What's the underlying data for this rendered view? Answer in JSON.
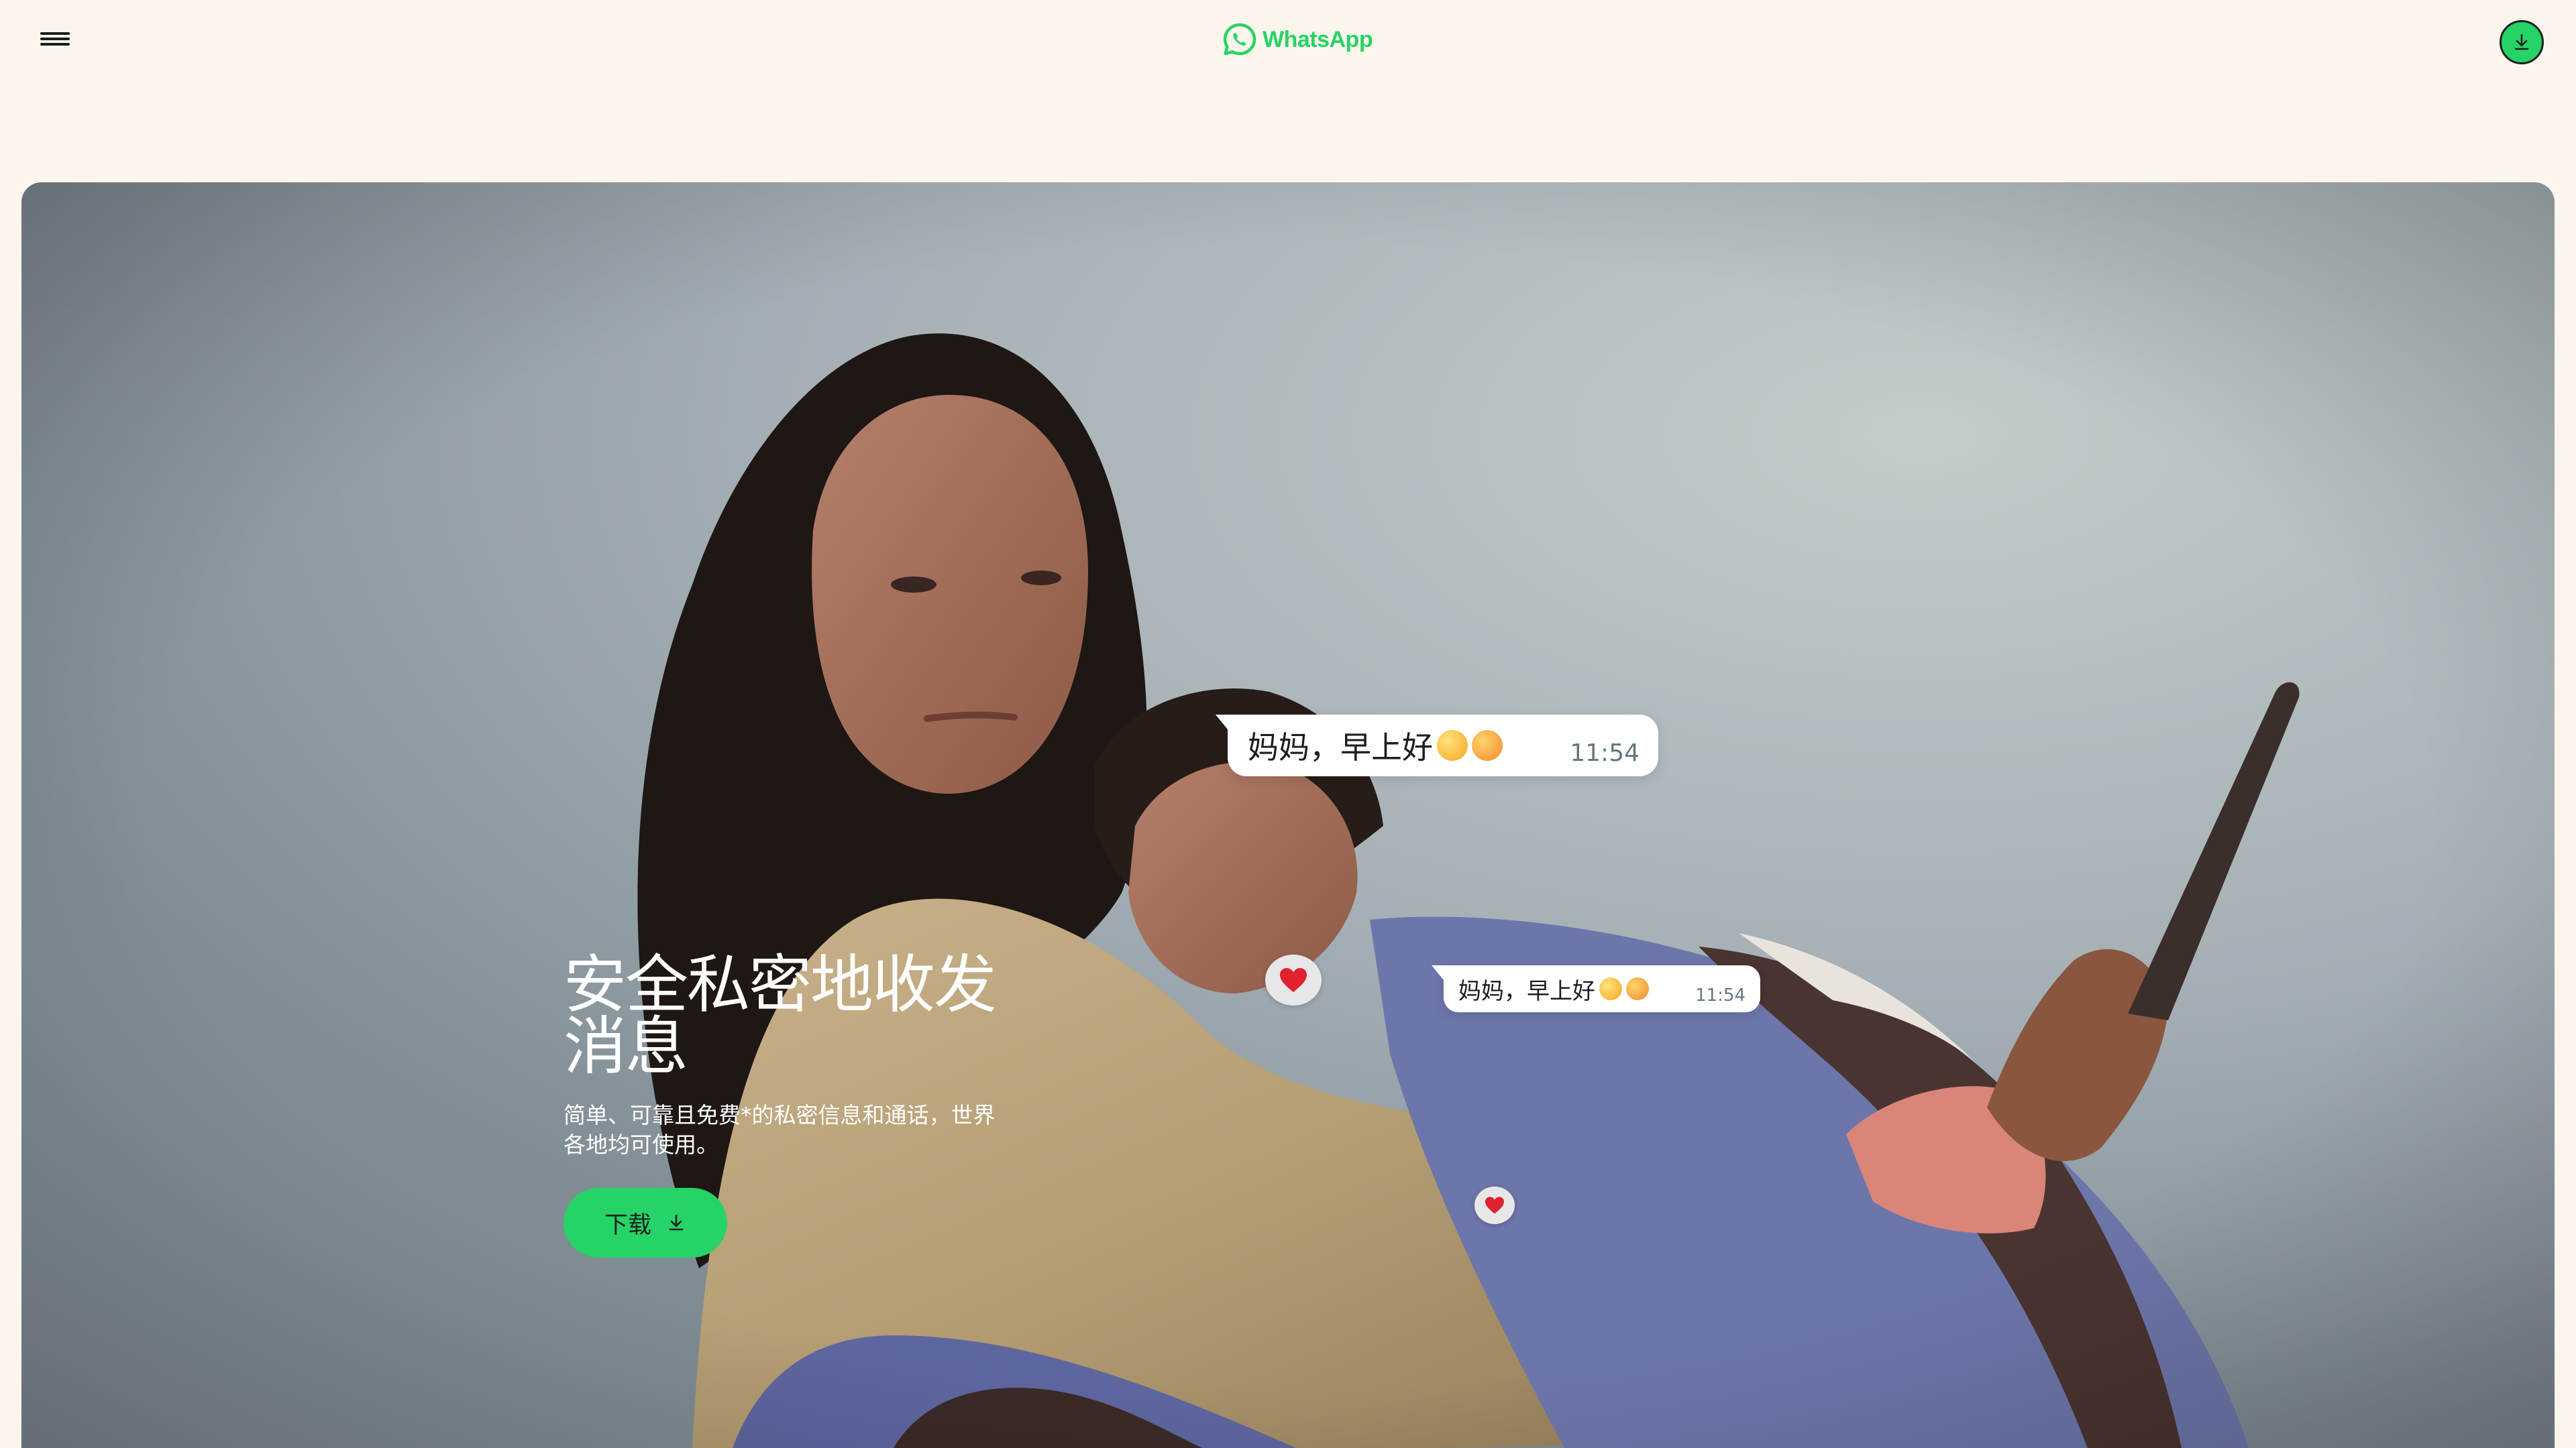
{
  "header": {
    "menu_icon": "hamburger-menu-icon",
    "logo_icon": "whatsapp-logo-icon",
    "logo_text": "WhatsApp",
    "download_icon": "download-icon"
  },
  "hero": {
    "title": "安全私密地收发消息",
    "subtitle": "简单、可靠且免费*的私密信息和通话，世界各地均可使用。",
    "button_label": "下载",
    "button_icon": "download-arrow-icon"
  },
  "chat": {
    "bubble_large": {
      "text": "妈妈，早上好",
      "emojis": [
        "smiling-face-emoji",
        "smiling-face-with-hearts-emoji"
      ],
      "time": "11:54",
      "reaction": "red-heart-emoji"
    },
    "bubble_small": {
      "text": "妈妈，早上好",
      "emojis": [
        "smiling-face-emoji",
        "smiling-face-with-hearts-emoji"
      ],
      "time": "11:54",
      "reaction": "red-heart-emoji"
    }
  },
  "colors": {
    "page_bg": "#fcf5eb",
    "brand_green": "#25d366",
    "text_dark": "#1c1e21",
    "time_grey": "#667781"
  }
}
